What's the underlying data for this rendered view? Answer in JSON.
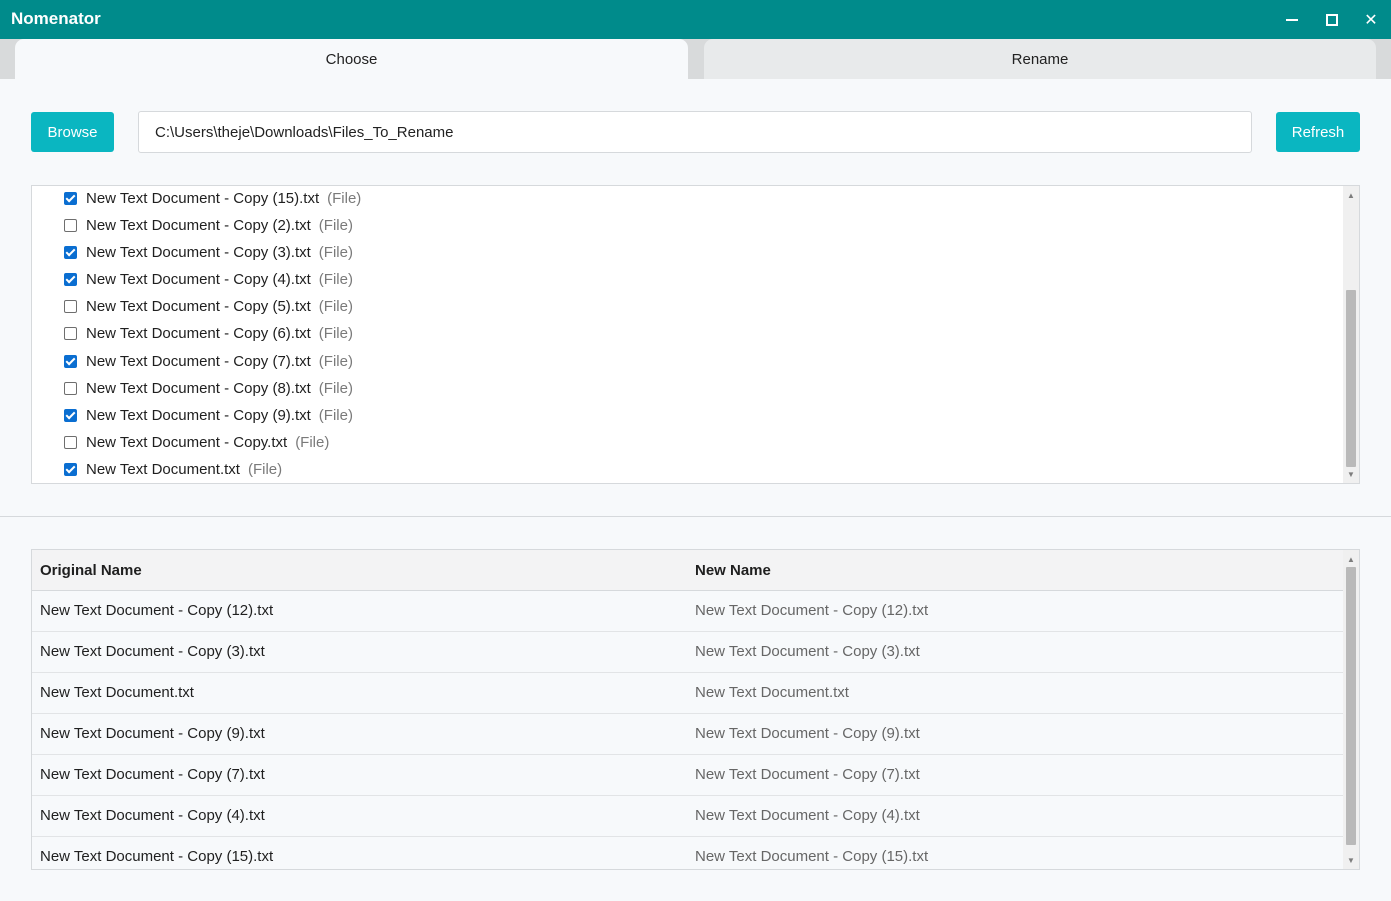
{
  "app": {
    "title": "Nomenator"
  },
  "window_controls": {
    "minimize": "minimize-icon",
    "maximize": "maximize-icon",
    "close": "close-icon"
  },
  "tabs": [
    {
      "label": "Choose",
      "active": true
    },
    {
      "label": "Rename",
      "active": false
    }
  ],
  "toolbar": {
    "browse_label": "Browse",
    "refresh_label": "Refresh",
    "path_value": "C:\\Users\\theje\\Downloads\\Files_To_Rename"
  },
  "files": [
    {
      "name": "New Text Document - Copy (15).txt",
      "kind": "(File)",
      "checked": true
    },
    {
      "name": "New Text Document - Copy (2).txt",
      "kind": "(File)",
      "checked": false
    },
    {
      "name": "New Text Document - Copy (3).txt",
      "kind": "(File)",
      "checked": true
    },
    {
      "name": "New Text Document - Copy (4).txt",
      "kind": "(File)",
      "checked": true
    },
    {
      "name": "New Text Document - Copy (5).txt",
      "kind": "(File)",
      "checked": false
    },
    {
      "name": "New Text Document - Copy (6).txt",
      "kind": "(File)",
      "checked": false
    },
    {
      "name": "New Text Document - Copy (7).txt",
      "kind": "(File)",
      "checked": true
    },
    {
      "name": "New Text Document - Copy (8).txt",
      "kind": "(File)",
      "checked": false
    },
    {
      "name": "New Text Document - Copy (9).txt",
      "kind": "(File)",
      "checked": true
    },
    {
      "name": "New Text Document - Copy.txt",
      "kind": "(File)",
      "checked": false
    },
    {
      "name": "New Text Document.txt",
      "kind": "(File)",
      "checked": true
    }
  ],
  "preview_table": {
    "headers": {
      "original": "Original Name",
      "new": "New Name"
    },
    "rows": [
      {
        "original": "New Text Document - Copy (12).txt",
        "new": "New Text Document - Copy (12).txt"
      },
      {
        "original": "New Text Document - Copy (3).txt",
        "new": "New Text Document - Copy (3).txt"
      },
      {
        "original": "New Text Document.txt",
        "new": "New Text Document.txt"
      },
      {
        "original": "New Text Document - Copy (9).txt",
        "new": "New Text Document - Copy (9).txt"
      },
      {
        "original": "New Text Document - Copy (7).txt",
        "new": "New Text Document - Copy (7).txt"
      },
      {
        "original": "New Text Document - Copy (4).txt",
        "new": "New Text Document - Copy (4).txt"
      },
      {
        "original": "New Text Document - Copy (15).txt",
        "new": "New Text Document - Copy (15).txt"
      }
    ]
  },
  "colors": {
    "titlebar": "#008b8b",
    "accent_button": "#0ab6c1",
    "checkbox": "#0a6ed1"
  }
}
